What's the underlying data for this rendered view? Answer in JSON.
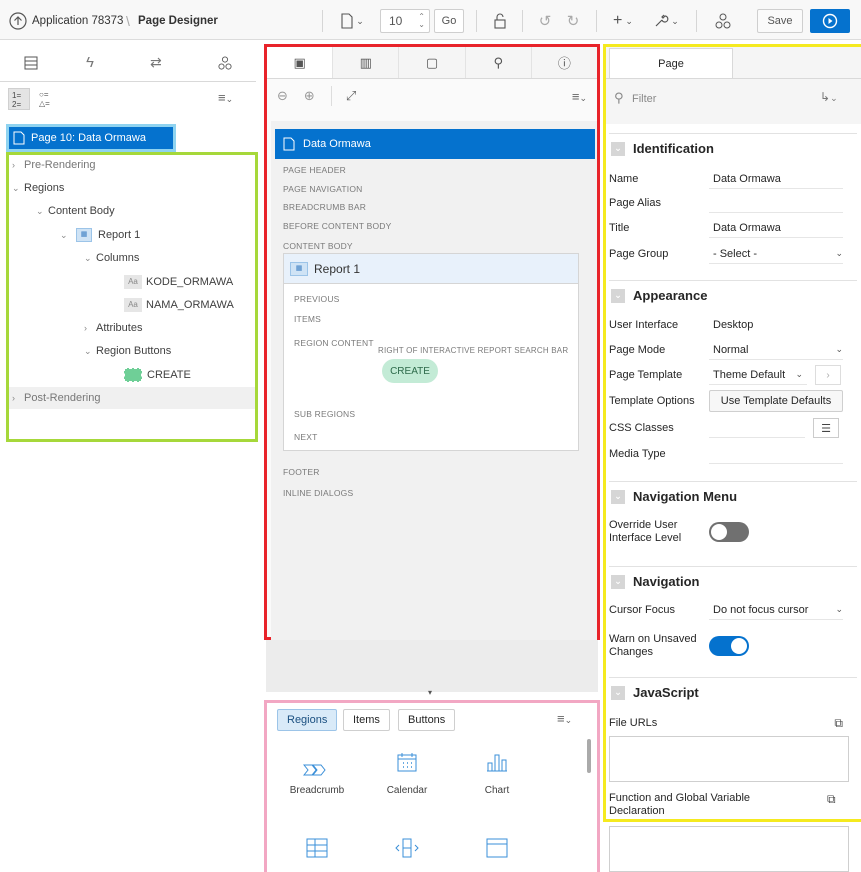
{
  "topbar": {
    "app_label": "Application 78373",
    "page_designer_label": "Page Designer",
    "page_number": "10",
    "go_label": "Go",
    "save_label": "Save"
  },
  "left_tree": {
    "page_item": "Page 10: Data Ormawa",
    "pre_rendering": "Pre-Rendering",
    "regions": "Regions",
    "content_body": "Content Body",
    "report": "Report 1",
    "columns": "Columns",
    "col1": "KODE_ORMAWA",
    "col2": "NAMA_ORMAWA",
    "attributes": "Attributes",
    "region_buttons": "Region Buttons",
    "create": "CREATE",
    "post_rendering": "Post-Rendering"
  },
  "layout": {
    "page_title": "Data Ormawa",
    "labels_top": [
      "PAGE HEADER",
      "PAGE NAVIGATION",
      "BREADCRUMB BAR",
      "BEFORE CONTENT BODY",
      "CONTENT BODY"
    ],
    "report_title": "Report 1",
    "previous": "PREVIOUS",
    "items": "ITEMS",
    "region_content": "REGION CONTENT",
    "right_of_search": "RIGHT OF INTERACTIVE REPORT SEARCH BAR",
    "create_button": "CREATE",
    "sub_regions": "SUB REGIONS",
    "next": "NEXT",
    "footer": "FOOTER",
    "inline_dialogs": "INLINE DIALOGS"
  },
  "gallery": {
    "tabs": [
      "Regions",
      "Items",
      "Buttons"
    ],
    "items": [
      "Breadcrumb",
      "Calendar",
      "Chart"
    ]
  },
  "props": {
    "tab_label": "Page",
    "filter_placeholder": "Filter",
    "identification": {
      "heading": "Identification",
      "name_label": "Name",
      "name_value": "Data Ormawa",
      "alias_label": "Page Alias",
      "alias_value": "",
      "title_label": "Title",
      "title_value": "Data Ormawa",
      "group_label": "Page Group",
      "group_value": "- Select -"
    },
    "appearance": {
      "heading": "Appearance",
      "ui_label": "User Interface",
      "ui_value": "Desktop",
      "mode_label": "Page Mode",
      "mode_value": "Normal",
      "template_label": "Page Template",
      "template_value": "Theme Default",
      "options_label": "Template Options",
      "options_button": "Use Template Defaults",
      "css_label": "CSS Classes",
      "media_label": "Media Type"
    },
    "navigation_menu": {
      "heading": "Navigation Menu",
      "override_label": "Override User Interface Level",
      "override_on": false
    },
    "navigation": {
      "heading": "Navigation",
      "cursor_label": "Cursor Focus",
      "cursor_value": "Do not focus cursor",
      "warn_label": "Warn on Unsaved Changes",
      "warn_on": true
    },
    "javascript": {
      "heading": "JavaScript",
      "file_urls_label": "File URLs",
      "function_label": "Function and Global Variable Declaration"
    }
  },
  "colors": {
    "accent": "#0572ce",
    "highlight_red": "#e8232a",
    "highlight_green": "#a6d83a",
    "highlight_yellow": "#f5ea1f",
    "highlight_pink": "#f2a7c3",
    "highlight_cyan": "#8fd3f0",
    "create_green": "#c3ebd6"
  }
}
